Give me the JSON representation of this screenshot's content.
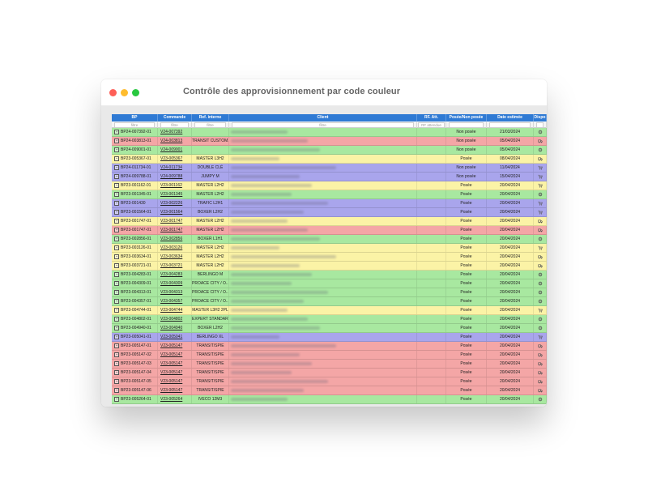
{
  "window": {
    "title": "Contrôle des approvisionnement par code couleur"
  },
  "colors": {
    "header": "#2f7ad4",
    "green": "#a8e8a0",
    "red": "#f4a6a6",
    "yellow": "#fbf3a6",
    "purple": "#a9a5ec"
  },
  "table": {
    "headers": {
      "bp": "BP",
      "commande": "Commande",
      "ref_interne": "Ref. interne",
      "client": "Client",
      "rf_att": "RF. Att.",
      "posee": "Posée/Non posée",
      "date": "Date estimée",
      "dispo": "Dispo"
    },
    "filters": {
      "bp": "filtre",
      "commande": "filtre",
      "ref_interne": "filtre",
      "client": "filtre",
      "rf_att": "RF attendue"
    },
    "rows": [
      {
        "bp": "BP24-007392-01",
        "commande": "V24-007392",
        "ref": "",
        "posee": "Non posée",
        "date": "21/03/2024",
        "color": "green",
        "icon": "gear-icon"
      },
      {
        "bp": "BP24-003813-01",
        "commande": "V24-003813",
        "ref": "TRANSIT CUSTOM...",
        "posee": "Non posée",
        "date": "05/04/2024",
        "color": "red",
        "icon": "truck-icon"
      },
      {
        "bp": "BP24-009001-01",
        "commande": "V24-009001",
        "ref": "",
        "posee": "Non posée",
        "date": "05/04/2024",
        "color": "green",
        "icon": "gear-icon"
      },
      {
        "bp": "BP23-005367-01",
        "commande": "V23-005367",
        "ref": "MASTER L3H2",
        "posee": "Posée",
        "date": "08/04/2024",
        "color": "yellow",
        "icon": "truck-icon"
      },
      {
        "bp": "BP24-011734-01",
        "commande": "V24-011734",
        "ref": "DOUBLE CLÉ",
        "posee": "Non posée",
        "date": "11/04/2024",
        "color": "purple",
        "icon": "cart-icon"
      },
      {
        "bp": "BP24-009788-01",
        "commande": "V24-009788",
        "ref": "JUMPY M",
        "posee": "Non posée",
        "date": "15/04/2024",
        "color": "purple",
        "icon": "cart-icon"
      },
      {
        "bp": "BP23-001162-01",
        "commande": "V23-001162",
        "ref": "MASTER L2H2",
        "posee": "Posée",
        "date": "20/04/2024",
        "color": "yellow",
        "icon": "cart-icon"
      },
      {
        "bp": "BP23-001345-01",
        "commande": "V23-001345",
        "ref": "MASTER L2H2",
        "posee": "Posée",
        "date": "20/04/2024",
        "color": "green",
        "icon": "gear-icon"
      },
      {
        "bp": "BP23-001430",
        "commande": "V23-002226",
        "ref": "TRAFIC L2H1",
        "posee": "Posée",
        "date": "20/04/2024",
        "color": "purple",
        "icon": "cart-icon"
      },
      {
        "bp": "BP23-001564-01",
        "commande": "V23-001564",
        "ref": "BOXER L2H2",
        "posee": "Posée",
        "date": "20/04/2024",
        "color": "purple",
        "icon": "cart-icon"
      },
      {
        "bp": "BP23-001747-01",
        "commande": "V23-001747",
        "ref": "MASTER L2H2",
        "posee": "Posée",
        "date": "20/04/2024",
        "color": "yellow",
        "icon": "truck-icon"
      },
      {
        "bp": "BP23-001747-01",
        "commande": "V23-001747",
        "ref": "MASTER L2H2",
        "posee": "Posée",
        "date": "20/04/2024",
        "color": "red",
        "icon": "truck-icon"
      },
      {
        "bp": "BP23-002856-01",
        "commande": "V23-002856",
        "ref": "BOXER L1H1",
        "posee": "Posée",
        "date": "20/04/2024",
        "color": "green",
        "icon": "gear-icon"
      },
      {
        "bp": "BP23-003126-01",
        "commande": "V23-003126",
        "ref": "MASTER L2H2",
        "posee": "Posée",
        "date": "20/04/2024",
        "color": "yellow",
        "icon": "cart-icon"
      },
      {
        "bp": "BP23-003634-01",
        "commande": "V23-003634",
        "ref": "MASTER L2H2",
        "posee": "Posée",
        "date": "20/04/2024",
        "color": "yellow",
        "icon": "truck-icon"
      },
      {
        "bp": "BP23-003721-01",
        "commande": "V23-003721",
        "ref": "MASTER L2H2",
        "posee": "Posée",
        "date": "20/04/2024",
        "color": "yellow",
        "icon": "truck-icon"
      },
      {
        "bp": "BP23-004283-01",
        "commande": "V23-004283",
        "ref": "BERLINGO M",
        "posee": "Posée",
        "date": "20/04/2024",
        "color": "green",
        "icon": "gear-icon"
      },
      {
        "bp": "BP23-004309-01",
        "commande": "V23-004309",
        "ref": "PROACE CITY / O...",
        "posee": "Posée",
        "date": "20/04/2024",
        "color": "green",
        "icon": "gear-icon"
      },
      {
        "bp": "BP23-004313-01",
        "commande": "V23-004313",
        "ref": "PROACE CITY / O...",
        "posee": "Posée",
        "date": "20/04/2024",
        "color": "green",
        "icon": "gear-icon"
      },
      {
        "bp": "BP23-004357-01",
        "commande": "V23-004357",
        "ref": "PROACE CITY / O...",
        "posee": "Posée",
        "date": "20/04/2024",
        "color": "green",
        "icon": "gear-icon"
      },
      {
        "bp": "BP23-004744-01",
        "commande": "V23-004744",
        "ref": "MASTER L3H2 2PL",
        "posee": "Posée",
        "date": "20/04/2024",
        "color": "yellow",
        "icon": "cart-icon"
      },
      {
        "bp": "BP23-004802-01",
        "commande": "V23-004802",
        "ref": "EXPERT STANDARD",
        "posee": "Posée",
        "date": "20/04/2024",
        "color": "green",
        "icon": "gear-icon"
      },
      {
        "bp": "BP23-004940-01",
        "commande": "V23-004940",
        "ref": "BOXER L2H2",
        "posee": "Posée",
        "date": "20/04/2024",
        "color": "green",
        "icon": "gear-icon"
      },
      {
        "bp": "BP23-005041-01",
        "commande": "V23-005041",
        "ref": "BERLINGO XL",
        "posee": "Posée",
        "date": "20/04/2024",
        "color": "purple",
        "icon": "cart-icon"
      },
      {
        "bp": "BP23-005147-01",
        "commande": "V23-005147",
        "ref": "TRANSIT/SPIE",
        "posee": "Posée",
        "date": "20/04/2024",
        "color": "red",
        "icon": "truck-icon"
      },
      {
        "bp": "BP23-005147-02",
        "commande": "V23-005147",
        "ref": "TRANSIT/SPIE",
        "posee": "Posée",
        "date": "20/04/2024",
        "color": "red",
        "icon": "truck-icon"
      },
      {
        "bp": "BP23-005147-03",
        "commande": "V23-005147",
        "ref": "TRANSIT/SPIE",
        "posee": "Posée",
        "date": "20/04/2024",
        "color": "red",
        "icon": "truck-icon"
      },
      {
        "bp": "BP23-005147-04",
        "commande": "V23-005147",
        "ref": "TRANSIT/SPIE",
        "posee": "Posée",
        "date": "20/04/2024",
        "color": "red",
        "icon": "truck-icon"
      },
      {
        "bp": "BP23-005147-05",
        "commande": "V23-005147",
        "ref": "TRANSIT/SPIE",
        "posee": "Posée",
        "date": "20/04/2024",
        "color": "red",
        "icon": "truck-icon"
      },
      {
        "bp": "BP23-005147-06",
        "commande": "V23-005147",
        "ref": "TRANSIT/SPIE",
        "posee": "Posée",
        "date": "20/04/2024",
        "color": "red",
        "icon": "truck-icon"
      },
      {
        "bp": "BP23-005264-01",
        "commande": "V23-005264",
        "ref": "IVECO 12M3",
        "posee": "Posée",
        "date": "20/04/2024",
        "color": "green",
        "icon": "gear-icon"
      }
    ]
  }
}
